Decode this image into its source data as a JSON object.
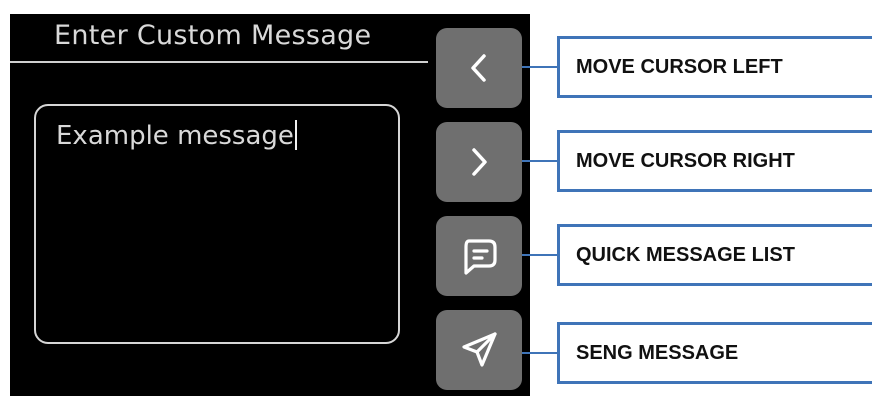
{
  "screen": {
    "title": "Enter Custom Message",
    "message_text": "Example message"
  },
  "buttons": [
    {
      "icon": "chevron-left-icon",
      "callout": "MOVE CURSOR LEFT"
    },
    {
      "icon": "chevron-right-icon",
      "callout": "MOVE CURSOR RIGHT"
    },
    {
      "icon": "message-icon",
      "callout": "QUICK MESSAGE LIST"
    },
    {
      "icon": "send-icon",
      "callout": "SENG MESSAGE"
    }
  ],
  "colors": {
    "screen_background": "#000000",
    "button_background": "#6f6f6f",
    "text": "#d9d9d9",
    "callout_border": "#3f74b8"
  }
}
